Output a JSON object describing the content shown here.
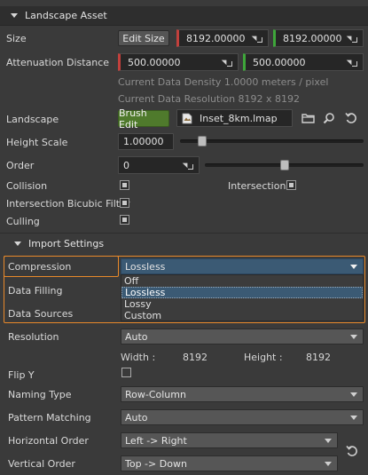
{
  "landscape_asset": {
    "section_title": "Landscape Asset",
    "size": {
      "label": "Size",
      "button": "Edit Size",
      "x": "8192.00000",
      "y": "8192.00000"
    },
    "attenuation": {
      "label": "Attenuation Distance",
      "x": "500.00000",
      "y": "500.00000"
    },
    "info_density": "Current Data Density 1.0000 meters / pixel",
    "info_resolution": "Current Data Resolution 8192 x 8192",
    "landscape": {
      "label": "Landscape",
      "button": "Brush Edit",
      "file": "Inset_8km.lmap"
    },
    "height_scale": {
      "label": "Height Scale",
      "value": "1.00000",
      "slider_fraction": 0.12
    },
    "order": {
      "label": "Order",
      "value": "0",
      "slider_fraction": 0.5
    },
    "collision": {
      "label": "Collision",
      "checked": true
    },
    "intersection": {
      "label": "Intersection",
      "checked": true
    },
    "bicubic": {
      "label": "Intersection Bicubic Filter",
      "checked": true
    },
    "culling": {
      "label": "Culling",
      "checked": true
    }
  },
  "import_settings": {
    "section_title": "Import Settings",
    "compression": {
      "label": "Compression",
      "value": "Lossless",
      "options": [
        "Off",
        "Lossless",
        "Lossy",
        "Custom"
      ],
      "selected_option": "Lossless"
    },
    "data_filling": {
      "label": "Data Filling"
    },
    "data_sources": {
      "label": "Data Sources"
    },
    "resolution": {
      "label": "Resolution",
      "value": "Auto"
    },
    "width": {
      "label": "Width :",
      "value": "8192"
    },
    "height": {
      "label": "Height :",
      "value": "8192"
    },
    "flip_y": {
      "label": "Flip Y",
      "checked": false
    },
    "naming_type": {
      "label": "Naming Type",
      "value": "Row-Column"
    },
    "pattern_matching": {
      "label": "Pattern Matching",
      "value": "Auto"
    },
    "horizontal_order": {
      "label": "Horizontal Order",
      "value": "Left -> Right"
    },
    "vertical_order": {
      "label": "Vertical Order",
      "value": "Top -> Down"
    }
  },
  "colors": {
    "accent_orange": "#e8892a",
    "axis_x": "#c2403c",
    "axis_y": "#3ea63a",
    "brush_green": "#4f7a2c",
    "selection_blue": "#3b5a74"
  }
}
